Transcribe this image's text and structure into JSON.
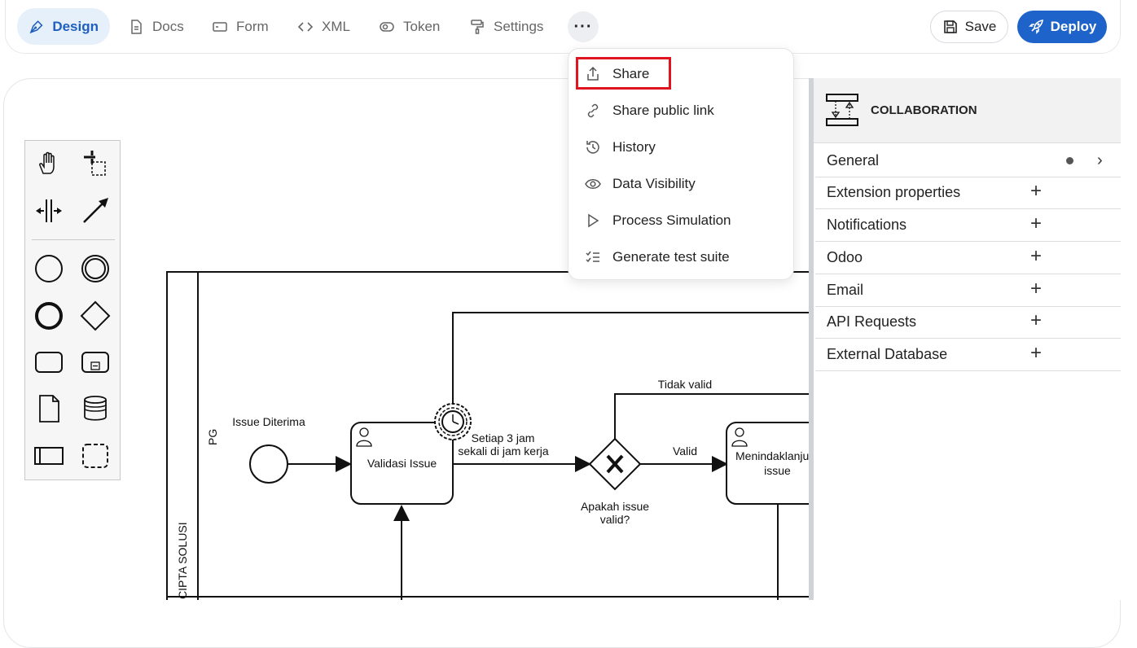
{
  "tabs": [
    {
      "label": "Design",
      "icon": "pen-icon",
      "active": true
    },
    {
      "label": "Docs",
      "icon": "document-icon"
    },
    {
      "label": "Form",
      "icon": "form-icon"
    },
    {
      "label": "XML",
      "icon": "code-icon"
    },
    {
      "label": "Token",
      "icon": "token-icon"
    },
    {
      "label": "Settings",
      "icon": "paint-roller-icon"
    }
  ],
  "toolbar": {
    "more_label": "···",
    "save_label": "Save",
    "deploy_label": "Deploy"
  },
  "colors": {
    "accent": "#1d63c9",
    "active_tab_bg": "#e6f0fb",
    "highlight": "#e0141e"
  },
  "menu": {
    "items": [
      {
        "label": "Share",
        "icon": "share-icon"
      },
      {
        "label": "Share public link",
        "icon": "link-icon"
      },
      {
        "label": "History",
        "icon": "history-icon"
      },
      {
        "label": "Data Visibility",
        "icon": "eye-icon"
      },
      {
        "label": "Process Simulation",
        "icon": "play-icon"
      },
      {
        "label": "Generate test suite",
        "icon": "checklist-icon"
      }
    ]
  },
  "panel": {
    "title": "COLLABORATION",
    "groups": [
      {
        "label": "General"
      },
      {
        "label": "Extension properties"
      },
      {
        "label": "Notifications"
      },
      {
        "label": "Odoo"
      },
      {
        "label": "Email"
      },
      {
        "label": "API Requests"
      },
      {
        "label": "External Database"
      }
    ]
  },
  "diagram": {
    "pool_label": "CIPTA SOLUSI",
    "lane_label": "PG",
    "start_event": "Issue Diterima",
    "task_validate": "Validasi Issue",
    "timer_label_1": "Setiap 3 jam",
    "timer_label_2": "sekali di jam kerja",
    "gateway_label_1": "Apakah issue",
    "gateway_label_2": "valid?",
    "flow_invalid": "Tidak valid",
    "flow_valid": "Valid",
    "task_follow_1": "Menindaklanju",
    "task_follow_2": "issue"
  }
}
